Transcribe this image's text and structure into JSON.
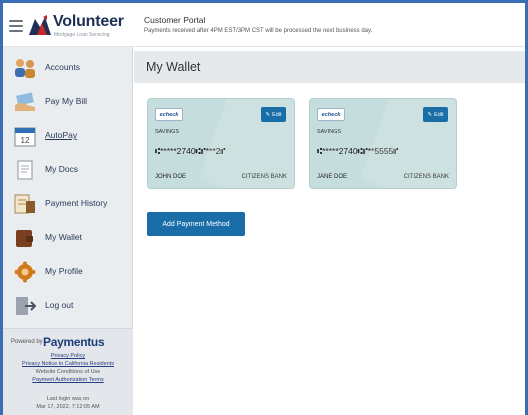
{
  "brand": {
    "name": "Volunteer",
    "tagline": "Mortgage Loan Servicing",
    "accent_color": "#1f2f55",
    "logo_color": "#c8262d"
  },
  "header": {
    "title": "Customer Portal",
    "note": "Payments received after 4PM EST/3PM CST will be processed the next business day."
  },
  "nav": {
    "items": [
      {
        "label": "Accounts",
        "icon": "accounts-icon"
      },
      {
        "label": "Pay My Bill",
        "icon": "pay-bill-icon"
      },
      {
        "label": "AutoPay",
        "icon": "calendar-icon",
        "calendar_day": "12"
      },
      {
        "label": "My Docs",
        "icon": "docs-icon"
      },
      {
        "label": "Payment History",
        "icon": "history-icon"
      },
      {
        "label": "My Wallet",
        "icon": "wallet-icon"
      },
      {
        "label": "My Profile",
        "icon": "profile-gear-icon"
      },
      {
        "label": "Log out",
        "icon": "logout-icon"
      }
    ]
  },
  "footer": {
    "powered_by": "Powered by",
    "provider": "Paymentus",
    "links": [
      "Privacy Policy",
      "Privacy Notice to California Residents"
    ],
    "plain": "Website Conditions of Use",
    "terms": "Payment Authorization Terms",
    "last_login_label": "Last login was on",
    "last_login_time": "Mar 17, 2022, 7:12:05 AM"
  },
  "main": {
    "title": "My Wallet",
    "cards": [
      {
        "badge": "echeck",
        "edit_label": "Edit",
        "type": "SAVINGS",
        "number": "⑆*****2740⑆⑈***2⑈",
        "holder": "JOHN DOE",
        "bank": "CITIZENS BANK"
      },
      {
        "badge": "echeck",
        "edit_label": "Edit",
        "type": "SAVINGS",
        "number": "⑆*****2740⑆⑈**5555⑈",
        "holder": "JANE DOE",
        "bank": "CITIZENS BANK"
      }
    ],
    "add_button": "Add Payment Method"
  },
  "colors": {
    "primary_button": "#1a6ea8",
    "card_bg": "#c6dddd",
    "sidebar_bg": "#eaedf0",
    "frame": "#3a6fb6"
  }
}
